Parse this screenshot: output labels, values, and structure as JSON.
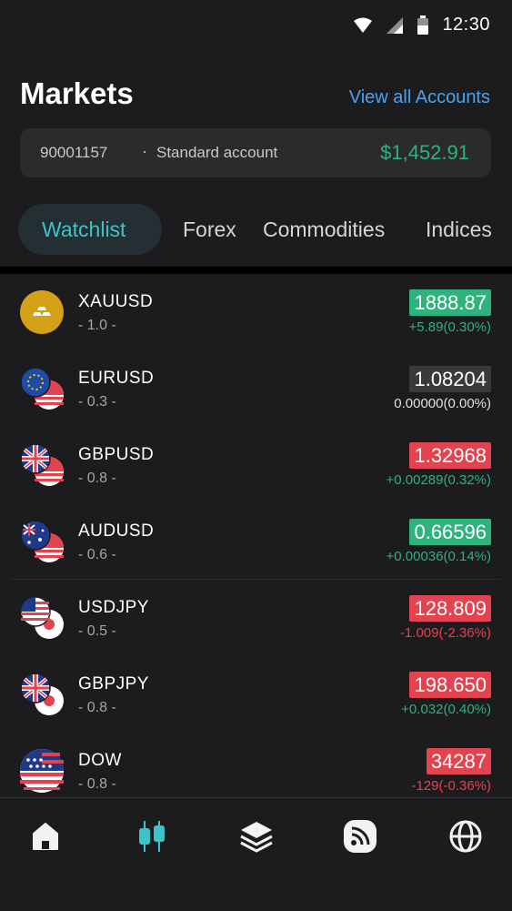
{
  "status_bar": {
    "time": "12:30"
  },
  "header": {
    "title": "Markets",
    "view_all_label": "View all Accounts"
  },
  "account": {
    "number": "90001157",
    "separator": "·",
    "type": "Standard account",
    "balance": "$1,452.91"
  },
  "tabs": [
    {
      "label": "Watchlist",
      "active": true
    },
    {
      "label": "Forex",
      "active": false
    },
    {
      "label": "Commodities",
      "active": false
    },
    {
      "label": "Indices",
      "active": false
    }
  ],
  "colors": {
    "up": "#2fb27c",
    "down": "#e2434f",
    "neutral": "#3a3a3d",
    "accent": "#3ec3c8",
    "link": "#4aa3f0"
  },
  "watchlist": [
    {
      "symbol": "XAUUSD",
      "lot": "- 1.0 -",
      "price": "1888.87",
      "change": "+5.89(0.30%)",
      "trend": "up",
      "icon": "gold-bars-icon"
    },
    {
      "symbol": "EURUSD",
      "lot": "- 0.3 -",
      "price": "1.08204",
      "change": "0.00000(0.00%)",
      "trend": "neutral",
      "icon": "eu-us-flags-icon"
    },
    {
      "symbol": "GBPUSD",
      "lot": "- 0.8 -",
      "price": "1.32968",
      "change": "+0.00289(0.32%)",
      "trend": "down-price-up-change",
      "icon": "uk-us-flags-icon"
    },
    {
      "symbol": "AUDUSD",
      "lot": "- 0.6 -",
      "price": "0.66596",
      "change": "+0.00036(0.14%)",
      "trend": "up",
      "icon": "au-us-flags-icon"
    },
    {
      "symbol": "USDJPY",
      "lot": "- 0.5 -",
      "price": "128.809",
      "change": "-1.009(-2.36%)",
      "trend": "down",
      "icon": "us-jp-flags-icon"
    },
    {
      "symbol": "GBPJPY",
      "lot": "- 0.8 -",
      "price": "198.650",
      "change": "+0.032(0.40%)",
      "trend": "down-price-up-change",
      "icon": "uk-jp-flags-icon"
    },
    {
      "symbol": "DOW",
      "lot": "- 0.8 -",
      "price": "34287",
      "change": "-129(-0.36%)",
      "trend": "down",
      "icon": "us-flag-icon"
    }
  ],
  "nav": [
    {
      "name": "home-icon",
      "active": false
    },
    {
      "name": "markets-candles-icon",
      "active": true
    },
    {
      "name": "layers-icon",
      "active": false
    },
    {
      "name": "feed-icon",
      "active": false
    },
    {
      "name": "globe-icon",
      "active": false
    }
  ]
}
